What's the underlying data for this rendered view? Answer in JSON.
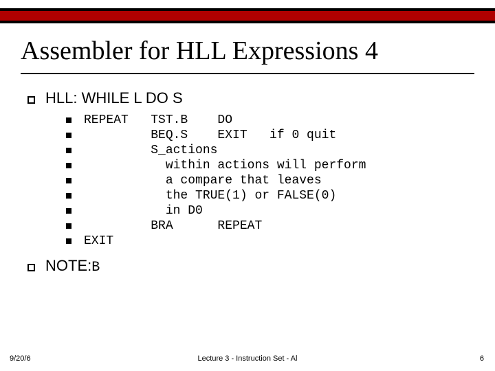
{
  "title": "Assembler for HLL Expressions 4",
  "hll": {
    "heading": "HLL:  WHILE L DO S",
    "lines": [
      "REPEAT   TST.B    DO",
      "         BEQ.S    EXIT   if 0 quit",
      "         S_actions",
      "           within actions will perform",
      "           a compare that leaves",
      "           the TRUE(1) or FALSE(0)",
      "           in D0",
      "         BRA      REPEAT",
      "EXIT"
    ]
  },
  "note": {
    "label": "NOTE:",
    "text": " B"
  },
  "footer": {
    "date": "9/20/6",
    "center": "Lecture 3 - Instruction Set - Al",
    "page": "6"
  }
}
